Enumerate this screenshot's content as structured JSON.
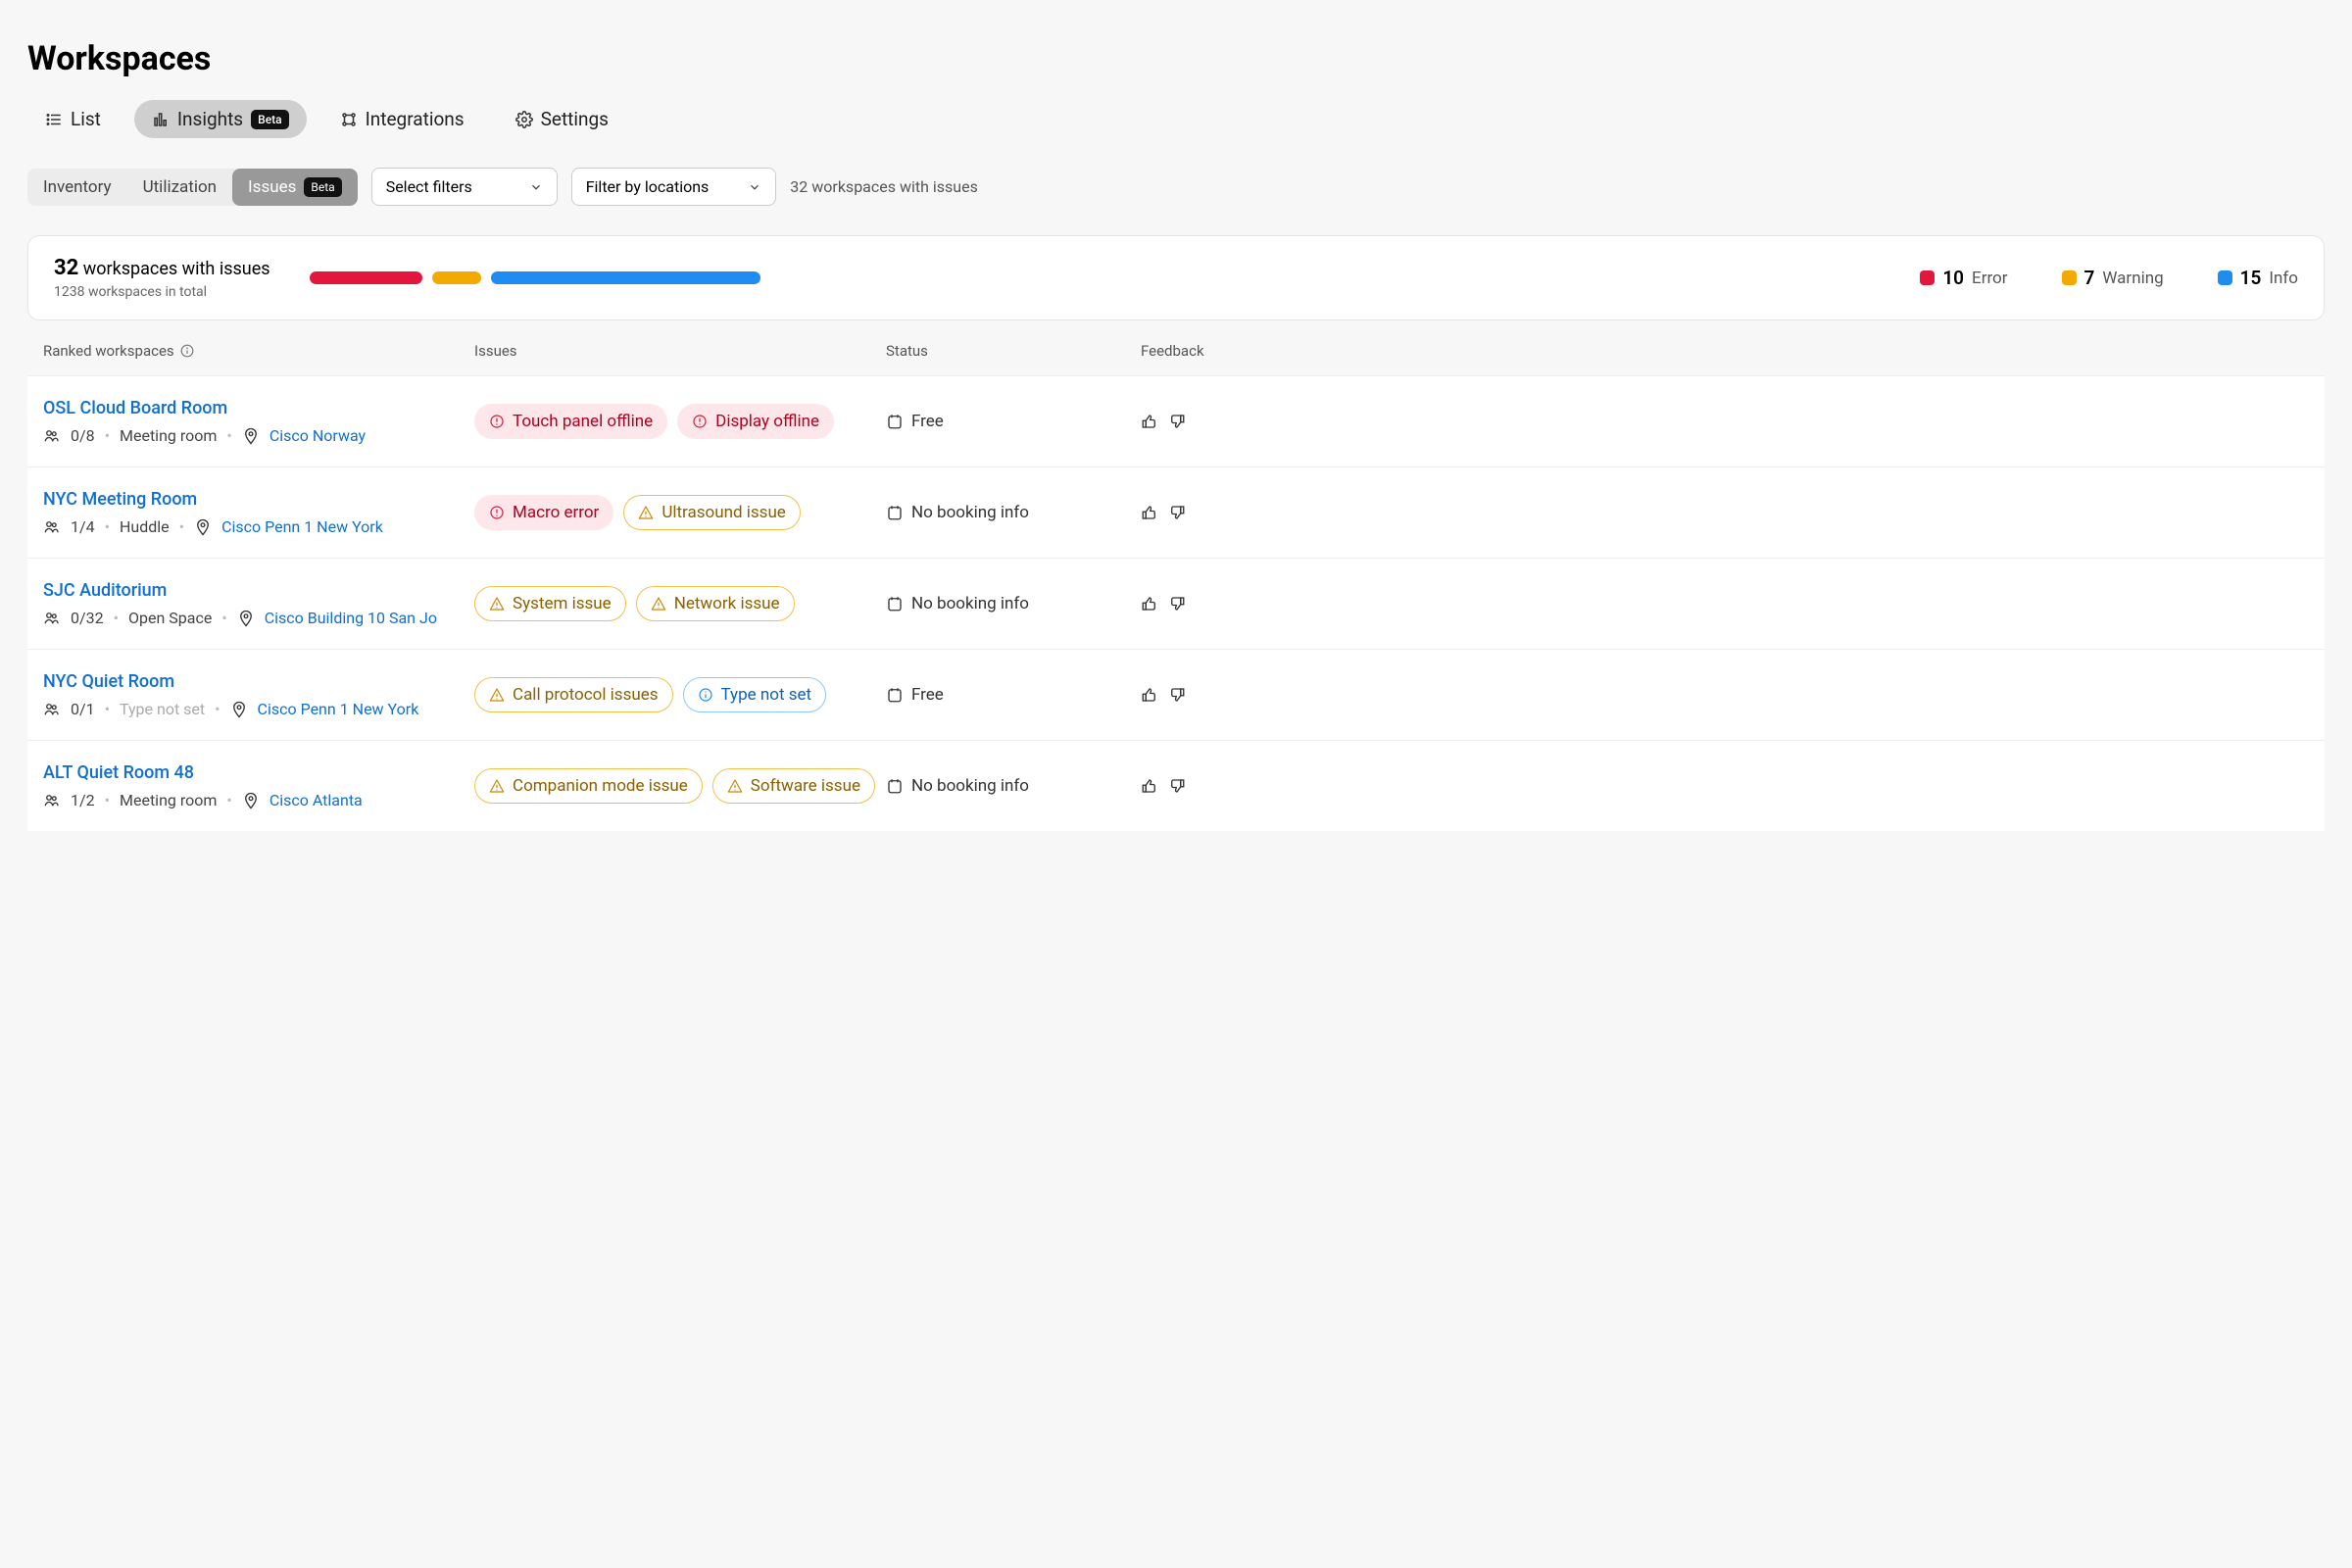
{
  "page": {
    "title": "Workspaces"
  },
  "tabs": {
    "list": "List",
    "insights": "Insights",
    "insights_badge": "Beta",
    "integrations": "Integrations",
    "settings": "Settings"
  },
  "subtabs": {
    "inventory": "Inventory",
    "utilization": "Utilization",
    "issues": "Issues",
    "issues_badge": "Beta"
  },
  "filters": {
    "select_filters": "Select filters",
    "filter_locations": "Filter by locations"
  },
  "summary_inline": "32 workspaces with issues",
  "summary": {
    "count": "32",
    "count_label": "workspaces with issues",
    "total": "1238 workspaces in total",
    "error_n": "10",
    "error_l": "Error",
    "warning_n": "7",
    "warning_l": "Warning",
    "info_n": "15",
    "info_l": "Info"
  },
  "columns": {
    "ranked": "Ranked workspaces",
    "issues": "Issues",
    "status": "Status",
    "feedback": "Feedback"
  },
  "rows": [
    {
      "name": "OSL Cloud Board Room",
      "occupancy": "0/8",
      "type": "Meeting room",
      "type_unset": false,
      "location": "Cisco Norway",
      "issues": [
        {
          "severity": "error",
          "label": "Touch panel offline"
        },
        {
          "severity": "error",
          "label": "Display offline"
        }
      ],
      "status": "Free"
    },
    {
      "name": "NYC Meeting Room",
      "occupancy": "1/4",
      "type": "Huddle",
      "type_unset": false,
      "location": "Cisco Penn 1 New York",
      "issues": [
        {
          "severity": "error",
          "label": "Macro error"
        },
        {
          "severity": "warning",
          "label": "Ultrasound issue"
        }
      ],
      "status": "No booking info"
    },
    {
      "name": "SJC Auditorium",
      "occupancy": "0/32",
      "type": "Open Space",
      "type_unset": false,
      "location": "Cisco Building 10 San Jo",
      "issues": [
        {
          "severity": "warning",
          "label": "System issue"
        },
        {
          "severity": "warning",
          "label": "Network issue"
        }
      ],
      "status": "No booking info"
    },
    {
      "name": "NYC Quiet Room",
      "occupancy": "0/1",
      "type": "Type not set",
      "type_unset": true,
      "location": "Cisco Penn 1 New York",
      "issues": [
        {
          "severity": "warning",
          "label": "Call protocol issues"
        },
        {
          "severity": "info",
          "label": "Type not set"
        }
      ],
      "status": "Free"
    },
    {
      "name": "ALT Quiet Room 48",
      "occupancy": "1/2",
      "type": "Meeting room",
      "type_unset": false,
      "location": "Cisco Atlanta",
      "issues": [
        {
          "severity": "warning",
          "label": "Companion mode issue"
        },
        {
          "severity": "warning",
          "label": "Software issue"
        }
      ],
      "status": "No booking info"
    }
  ]
}
